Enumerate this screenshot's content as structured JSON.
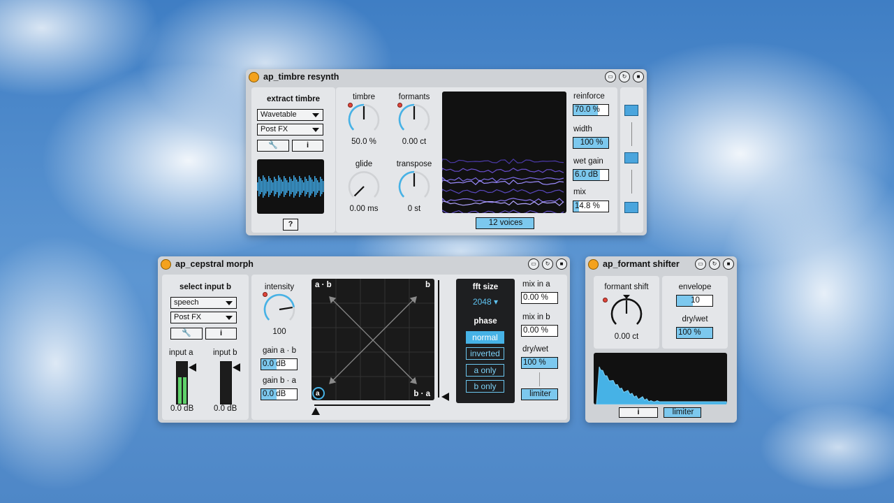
{
  "timbre_resynth": {
    "title": "ap_timbre resynth",
    "extract_label": "extract timbre",
    "source_menu": "Wavetable",
    "fx_menu": "Post FX",
    "info_glyph": "i",
    "help_glyph": "?",
    "knobs": [
      {
        "label": "timbre",
        "value": "50.0 %",
        "level": 0.5
      },
      {
        "label": "formants",
        "value": "0.00 ct",
        "level": 0.5
      },
      {
        "label": "glide",
        "value": "0.00 ms",
        "level": 0.0
      },
      {
        "label": "transpose",
        "value": "0 st",
        "level": 0.5
      }
    ],
    "voices_label": "12 voices",
    "params": [
      {
        "label": "reinforce",
        "value": "70.0 %",
        "fill": 0.7
      },
      {
        "label": "width",
        "value": "100 %",
        "fill": 1.0
      },
      {
        "label": "wet gain",
        "value": "6.0 dB",
        "fill": 0.75
      },
      {
        "label": "mix",
        "value": "14.8 %",
        "fill": 0.15
      }
    ]
  },
  "cepstral_morph": {
    "title": "ap_cepstral morph",
    "select_label": "select input b",
    "input_menu": "speech",
    "fx_menu": "Post FX",
    "info_glyph": "i",
    "input_a_label": "input a",
    "input_b_label": "input b",
    "input_a_db": "0.0 dB",
    "input_b_db": "0.0 dB",
    "intensity_label": "intensity",
    "intensity_value": "100",
    "gain_ab_label": "gain a · b",
    "gain_ab_value": "0.0 dB",
    "gain_ba_label": "gain b · a",
    "gain_ba_value": "0.0 dB",
    "pad_corners": {
      "tl": "a · b",
      "tr": "b",
      "bl": "a",
      "br": "b · a"
    },
    "fft_label": "fft size",
    "fft_value": "2048",
    "phase_label": "phase",
    "phase_options": [
      "normal",
      "inverted",
      "a only",
      "b only"
    ],
    "mix_a_label": "mix in a",
    "mix_a_value": "0.00 %",
    "mix_b_label": "mix in b",
    "mix_b_value": "0.00 %",
    "drywet_label": "dry/wet",
    "drywet_value": "100 %",
    "limiter_label": "limiter"
  },
  "formant_shifter": {
    "title": "ap_formant shifter",
    "shift_label": "formant shift",
    "shift_value": "0.00 ct",
    "envelope_label": "envelope",
    "envelope_value": "10",
    "drywet_label": "dry/wet",
    "drywet_value": "100 %",
    "info_glyph": "i",
    "limiter_label": "limiter"
  },
  "colors": {
    "accent": "#46b2e6",
    "title_dot": "#f4a21d",
    "panel": "#cfd2d6"
  }
}
